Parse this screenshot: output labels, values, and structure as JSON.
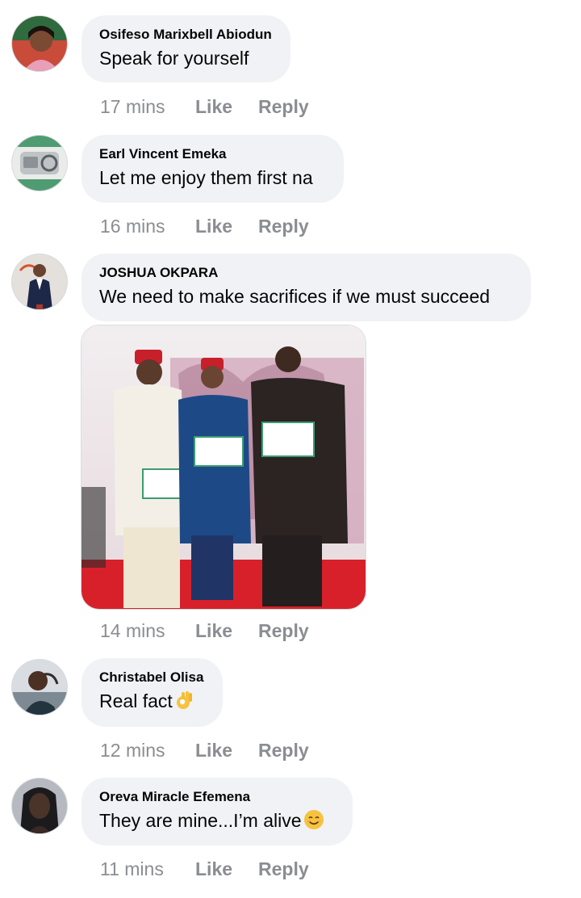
{
  "comments": [
    {
      "author": "Osifeso Marixbell Abiodun",
      "text": "Speak for yourself",
      "time": "17 mins",
      "like": "Like",
      "reply": "Reply"
    },
    {
      "author": "Earl Vincent Emeka",
      "text": "Let me enjoy them first na",
      "time": "16 mins",
      "like": "Like",
      "reply": "Reply"
    },
    {
      "author": "JOSHUA OKPARA",
      "text": "We need to make sacrifices if we must succeed",
      "time": "14 mins",
      "like": "Like",
      "reply": "Reply"
    },
    {
      "author": "Christabel Olisa",
      "text": "Real fact",
      "emoji": "ok-hand-emoji",
      "time": "12 mins",
      "like": "Like",
      "reply": "Reply"
    },
    {
      "author": "Oreva Miracle Efemena",
      "text": "They are mine...I’m alive",
      "emoji": "smiling-face-emoji",
      "time": "11 mins",
      "like": "Like",
      "reply": "Reply"
    }
  ],
  "colors": {
    "bubble": "#f0f2f5",
    "meta": "#8a8d91",
    "text": "#050505"
  }
}
